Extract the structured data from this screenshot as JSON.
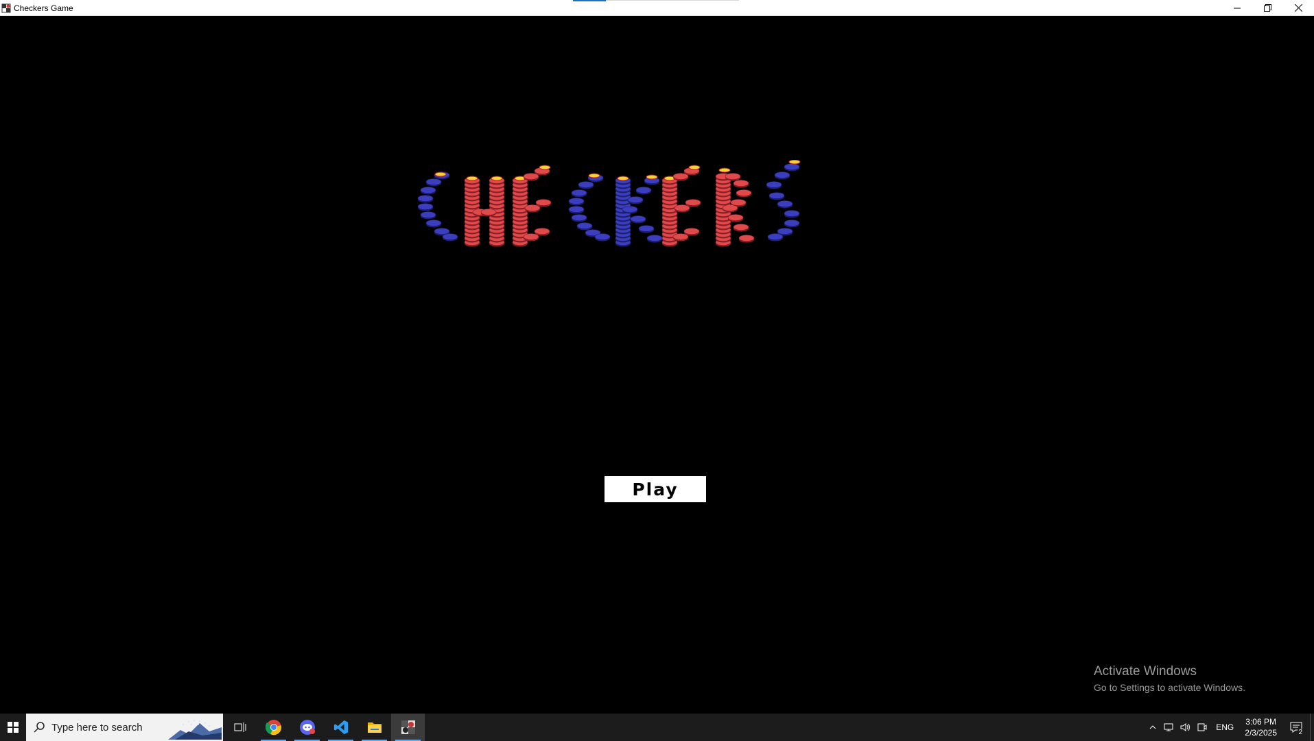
{
  "window": {
    "title": "Checkers Game",
    "controls": [
      "minimize",
      "restore",
      "close"
    ]
  },
  "game": {
    "logo_text": "CHECKERS",
    "logo_colors": {
      "red": "#e04a4a",
      "blue": "#3b3fbf",
      "crown": "#f5d23c"
    },
    "play_label": "Play"
  },
  "watermark": {
    "line1": "Activate Windows",
    "line2": "Go to Settings to activate Windows."
  },
  "taskbar": {
    "search_placeholder": "Type here to search",
    "apps": [
      {
        "icon": "task-view-icon"
      },
      {
        "icon": "chrome-icon"
      },
      {
        "icon": "discord-icon"
      },
      {
        "icon": "vscode-icon"
      },
      {
        "icon": "file-explorer-icon"
      },
      {
        "icon": "checkers-app-icon",
        "active": true
      }
    ],
    "tray": {
      "language": "ENG",
      "time": "3:06 PM",
      "date": "2/3/2025",
      "notification_count": "2"
    }
  }
}
